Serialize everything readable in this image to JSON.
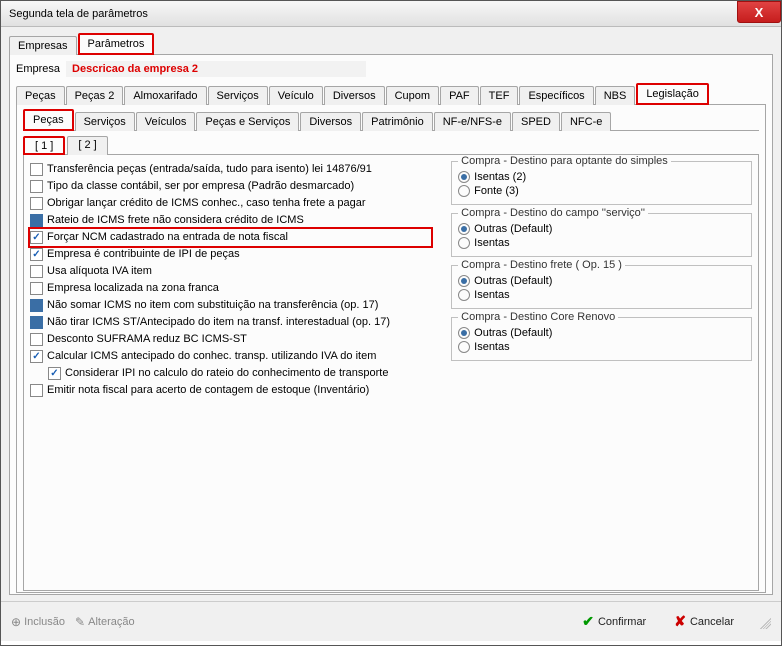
{
  "window": {
    "title": "Segunda tela de parâmetros",
    "close": "X"
  },
  "topTabs": {
    "empresas": "Empresas",
    "parametros": "Parâmetros"
  },
  "empresa": {
    "label": "Empresa",
    "desc": "Descricao da empresa 2"
  },
  "mainTabs": [
    "Peças",
    "Peças 2",
    "Almoxarifado",
    "Serviços",
    "Veículo",
    "Diversos",
    "Cupom",
    "PAF",
    "TEF",
    "Específicos",
    "NBS",
    "Legislação"
  ],
  "subTabs": [
    "Peças",
    "Serviços",
    "Veículos",
    "Peças e Serviços",
    "Diversos",
    "Patrimônio",
    "NF-e/NFS-e",
    "SPED",
    "NFC-e"
  ],
  "numTabs": [
    "[ 1 ]",
    "[ 2 ]"
  ],
  "checks": [
    {
      "label": "Transferência peças (entrada/saída, tudo para isento) lei 14876/91",
      "state": ""
    },
    {
      "label": "Tipo da classe contábil, ser por empresa (Padrão desmarcado)",
      "state": ""
    },
    {
      "label": "Obrigar lançar crédito de ICMS conhec., caso tenha frete a pagar",
      "state": ""
    },
    {
      "label": "Rateio de ICMS frete não considera crédito de ICMS",
      "state": "filled"
    },
    {
      "label": "Forçar NCM cadastrado na entrada de nota fiscal",
      "state": "checked"
    },
    {
      "label": "Empresa é contribuinte de IPI de peças",
      "state": "checked"
    },
    {
      "label": "Usa alíquota IVA item",
      "state": ""
    },
    {
      "label": "Empresa localizada na zona franca",
      "state": ""
    },
    {
      "label": "Não somar ICMS no item com substituição na transferência (op. 17)",
      "state": "filled"
    },
    {
      "label": "Não tirar ICMS ST/Antecipado do item na transf. interestadual (op. 17)",
      "state": "filled"
    },
    {
      "label": "Desconto SUFRAMA reduz BC ICMS-ST",
      "state": ""
    },
    {
      "label": "Calcular ICMS antecipado do conhec. transp. utilizando IVA do item",
      "state": "checked"
    },
    {
      "label": "Considerar IPI no calculo do rateio do conhecimento de transporte",
      "state": "checked",
      "indent": true
    },
    {
      "label": "Emitir nota fiscal para acerto de contagem de estoque (Inventário)",
      "state": ""
    }
  ],
  "groups": [
    {
      "legend": "Compra - Destino para optante do simples",
      "options": [
        {
          "label": "Isentas (2)",
          "selected": true
        },
        {
          "label": "Fonte (3)",
          "selected": false
        }
      ]
    },
    {
      "legend": "Compra - Destino do campo ''serviço''",
      "options": [
        {
          "label": "Outras (Default)",
          "selected": true
        },
        {
          "label": "Isentas",
          "selected": false
        }
      ]
    },
    {
      "legend": "Compra - Destino frete ( Op. 15 )",
      "options": [
        {
          "label": "Outras (Default)",
          "selected": true
        },
        {
          "label": "Isentas",
          "selected": false
        }
      ]
    },
    {
      "legend": "Compra - Destino Core Renovo",
      "options": [
        {
          "label": "Outras (Default)",
          "selected": true
        },
        {
          "label": "Isentas",
          "selected": false
        }
      ]
    }
  ],
  "footer": {
    "inclusao": "Inclusão",
    "alteracao": "Alteração",
    "confirmar": "Confirmar",
    "cancelar": "Cancelar"
  }
}
